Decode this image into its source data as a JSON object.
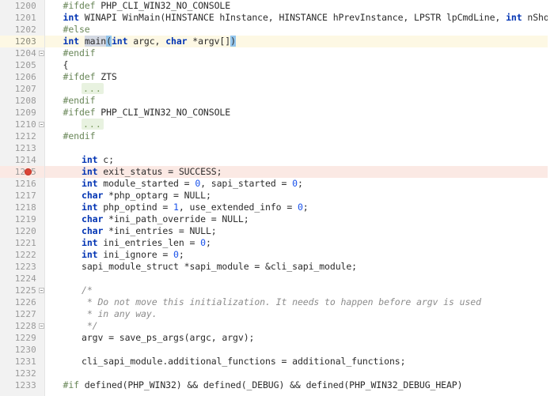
{
  "editor": {
    "theme": "light",
    "gutter_bg": "#f2f2f2",
    "caret_line_bg": "#fdf8e4",
    "breakpoint_line_bg": "#fbe9e4",
    "breakpoint_color": "#db4437",
    "keyword_color": "#0033b3",
    "preprocessor_color": "#6a8759",
    "number_color": "#1750eb",
    "comment_color": "#8c8c8c",
    "selection_color": "#d4d9e3",
    "brace_match_color": "#93c5ec",
    "fold_placeholder": "...",
    "first_line": 1200,
    "last_line": 1233
  },
  "lines": [
    {
      "num": "1200",
      "indent": 1,
      "fold": false,
      "breakpoint": false,
      "caret": false,
      "tokens": [
        {
          "t": "#ifdef",
          "c": "pp"
        },
        {
          "t": " PHP_CLI_WIN32_NO_CONSOLE",
          "c": "id"
        }
      ]
    },
    {
      "num": "1201",
      "indent": 1,
      "fold": false,
      "breakpoint": false,
      "caret": false,
      "tokens": [
        {
          "t": "int",
          "c": "kw"
        },
        {
          "t": " WINAPI WinMain(HINSTANCE hInstance, HINSTANCE hPrevInstance, LPSTR lpCmdLine, ",
          "c": "id"
        },
        {
          "t": "int",
          "c": "kw"
        },
        {
          "t": " nShowCmd)",
          "c": "id"
        }
      ]
    },
    {
      "num": "1202",
      "indent": 1,
      "fold": false,
      "breakpoint": false,
      "caret": false,
      "tokens": [
        {
          "t": "#else",
          "c": "pp"
        }
      ]
    },
    {
      "num": "1203",
      "indent": 1,
      "fold": false,
      "breakpoint": false,
      "caret": true,
      "tokens": [
        {
          "t": "int",
          "c": "kw"
        },
        {
          "t": " ",
          "c": "id"
        },
        {
          "t": "main",
          "c": "id sel"
        },
        {
          "t": "|CARET|",
          "c": "caret"
        },
        {
          "t": "(",
          "c": "id brace-hl"
        },
        {
          "t": "int",
          "c": "kw"
        },
        {
          "t": " argc, ",
          "c": "id"
        },
        {
          "t": "char",
          "c": "kw"
        },
        {
          "t": " *argv[]",
          "c": "id"
        },
        {
          "t": ")",
          "c": "id brace-hl"
        }
      ]
    },
    {
      "num": "1204",
      "indent": 1,
      "fold": true,
      "breakpoint": false,
      "caret": false,
      "tokens": [
        {
          "t": "#endif",
          "c": "pp"
        }
      ]
    },
    {
      "num": "1205",
      "indent": 1,
      "fold": false,
      "breakpoint": false,
      "caret": false,
      "tokens": [
        {
          "t": "{",
          "c": "id"
        }
      ]
    },
    {
      "num": "1206",
      "indent": 1,
      "fold": false,
      "breakpoint": false,
      "caret": false,
      "tokens": [
        {
          "t": "#ifdef",
          "c": "pp"
        },
        {
          "t": " ZTS",
          "c": "id"
        }
      ]
    },
    {
      "num": "1207",
      "indent": 2,
      "fold": false,
      "breakpoint": false,
      "caret": false,
      "tokens": [
        {
          "t": "...",
          "c": "folded"
        }
      ]
    },
    {
      "num": "1208",
      "indent": 1,
      "fold": false,
      "breakpoint": false,
      "caret": false,
      "tokens": [
        {
          "t": "#endif",
          "c": "pp"
        }
      ]
    },
    {
      "num": "1209",
      "indent": 1,
      "fold": false,
      "breakpoint": false,
      "caret": false,
      "tokens": [
        {
          "t": "#ifdef",
          "c": "pp"
        },
        {
          "t": " PHP_CLI_WIN32_NO_CONSOLE",
          "c": "id"
        }
      ]
    },
    {
      "num": "1210",
      "indent": 2,
      "fold": true,
      "breakpoint": false,
      "caret": false,
      "tokens": [
        {
          "t": "...",
          "c": "folded"
        }
      ]
    },
    {
      "num": "1212",
      "indent": 1,
      "fold": false,
      "breakpoint": false,
      "caret": false,
      "tokens": [
        {
          "t": "#endif",
          "c": "pp"
        }
      ]
    },
    {
      "num": "1213",
      "indent": 0,
      "fold": false,
      "breakpoint": false,
      "caret": false,
      "tokens": []
    },
    {
      "num": "1214",
      "indent": 2,
      "fold": false,
      "breakpoint": false,
      "caret": false,
      "tokens": [
        {
          "t": "int",
          "c": "kw"
        },
        {
          "t": " c;",
          "c": "id"
        }
      ]
    },
    {
      "num": "1215",
      "indent": 2,
      "fold": false,
      "breakpoint": true,
      "caret": false,
      "tokens": [
        {
          "t": "int",
          "c": "kw"
        },
        {
          "t": " exit_status = SUCCESS;",
          "c": "id"
        }
      ]
    },
    {
      "num": "1216",
      "indent": 2,
      "fold": false,
      "breakpoint": false,
      "caret": false,
      "tokens": [
        {
          "t": "int",
          "c": "kw"
        },
        {
          "t": " module_started = ",
          "c": "id"
        },
        {
          "t": "0",
          "c": "num"
        },
        {
          "t": ", sapi_started = ",
          "c": "id"
        },
        {
          "t": "0",
          "c": "num"
        },
        {
          "t": ";",
          "c": "id"
        }
      ]
    },
    {
      "num": "1217",
      "indent": 2,
      "fold": false,
      "breakpoint": false,
      "caret": false,
      "tokens": [
        {
          "t": "char",
          "c": "kw"
        },
        {
          "t": " *php_optarg = NULL;",
          "c": "id"
        }
      ]
    },
    {
      "num": "1218",
      "indent": 2,
      "fold": false,
      "breakpoint": false,
      "caret": false,
      "tokens": [
        {
          "t": "int",
          "c": "kw"
        },
        {
          "t": " php_optind = ",
          "c": "id"
        },
        {
          "t": "1",
          "c": "num"
        },
        {
          "t": ", use_extended_info = ",
          "c": "id"
        },
        {
          "t": "0",
          "c": "num"
        },
        {
          "t": ";",
          "c": "id"
        }
      ]
    },
    {
      "num": "1219",
      "indent": 2,
      "fold": false,
      "breakpoint": false,
      "caret": false,
      "tokens": [
        {
          "t": "char",
          "c": "kw"
        },
        {
          "t": " *ini_path_override = NULL;",
          "c": "id"
        }
      ]
    },
    {
      "num": "1220",
      "indent": 2,
      "fold": false,
      "breakpoint": false,
      "caret": false,
      "tokens": [
        {
          "t": "char",
          "c": "kw"
        },
        {
          "t": " *ini_entries = NULL;",
          "c": "id"
        }
      ]
    },
    {
      "num": "1221",
      "indent": 2,
      "fold": false,
      "breakpoint": false,
      "caret": false,
      "tokens": [
        {
          "t": "int",
          "c": "kw"
        },
        {
          "t": " ini_entries_len = ",
          "c": "id"
        },
        {
          "t": "0",
          "c": "num"
        },
        {
          "t": ";",
          "c": "id"
        }
      ]
    },
    {
      "num": "1222",
      "indent": 2,
      "fold": false,
      "breakpoint": false,
      "caret": false,
      "tokens": [
        {
          "t": "int",
          "c": "kw"
        },
        {
          "t": " ini_ignore = ",
          "c": "id"
        },
        {
          "t": "0",
          "c": "num"
        },
        {
          "t": ";",
          "c": "id"
        }
      ]
    },
    {
      "num": "1223",
      "indent": 2,
      "fold": false,
      "breakpoint": false,
      "caret": false,
      "tokens": [
        {
          "t": "sapi_module_struct *sapi_module = &cli_sapi_module;",
          "c": "id"
        }
      ]
    },
    {
      "num": "1224",
      "indent": 0,
      "fold": false,
      "breakpoint": false,
      "caret": false,
      "tokens": []
    },
    {
      "num": "1225",
      "indent": 2,
      "fold": true,
      "breakpoint": false,
      "caret": false,
      "tokens": [
        {
          "t": "/*",
          "c": "cmt"
        }
      ]
    },
    {
      "num": "1226",
      "indent": 2,
      "fold": false,
      "breakpoint": false,
      "caret": false,
      "tokens": [
        {
          "t": " * Do not move this initialization. It needs to happen before argv is used",
          "c": "cmt"
        }
      ]
    },
    {
      "num": "1227",
      "indent": 2,
      "fold": false,
      "breakpoint": false,
      "caret": false,
      "tokens": [
        {
          "t": " * in any way.",
          "c": "cmt"
        }
      ]
    },
    {
      "num": "1228",
      "indent": 2,
      "fold": true,
      "breakpoint": false,
      "caret": false,
      "tokens": [
        {
          "t": " */",
          "c": "cmt"
        }
      ]
    },
    {
      "num": "1229",
      "indent": 2,
      "fold": false,
      "breakpoint": false,
      "caret": false,
      "tokens": [
        {
          "t": "argv = save_ps_args(argc, argv);",
          "c": "id"
        }
      ]
    },
    {
      "num": "1230",
      "indent": 0,
      "fold": false,
      "breakpoint": false,
      "caret": false,
      "tokens": []
    },
    {
      "num": "1231",
      "indent": 2,
      "fold": false,
      "breakpoint": false,
      "caret": false,
      "tokens": [
        {
          "t": "cli_sapi_module.additional_functions = additional_functions;",
          "c": "id"
        }
      ]
    },
    {
      "num": "1232",
      "indent": 0,
      "fold": false,
      "breakpoint": false,
      "caret": false,
      "tokens": []
    },
    {
      "num": "1233",
      "indent": 1,
      "fold": false,
      "breakpoint": false,
      "caret": false,
      "clipped": true,
      "tokens": [
        {
          "t": "#if",
          "c": "pp"
        },
        {
          "t": " defined(PHP_WIN32) && defined(_DEBUG) && defined(PHP_WIN32_DEBUG_HEAP)",
          "c": "id"
        }
      ]
    }
  ]
}
